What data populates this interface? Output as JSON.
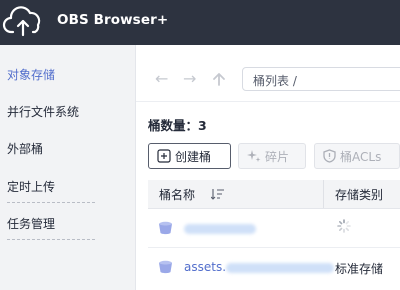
{
  "app": {
    "title": "OBS Browser+"
  },
  "sidebar": {
    "items": [
      {
        "label": "对象存储",
        "active": true
      },
      {
        "label": "并行文件系统",
        "active": false
      },
      {
        "label": "外部桶",
        "active": false
      },
      {
        "label": "定时上传",
        "active": false
      },
      {
        "label": "任务管理",
        "active": false
      }
    ]
  },
  "nav": {
    "path": "桶列表 /"
  },
  "summary": {
    "bucket_count": "桶数量：3"
  },
  "toolbar": {
    "create_bucket": "创建桶",
    "fragments": "碎片",
    "bucket_acls": "桶ACLs"
  },
  "table": {
    "columns": [
      "桶名称",
      "存储类别"
    ],
    "rows": [
      {
        "name": "",
        "storage_class": ""
      },
      {
        "name": "assets.",
        "storage_class": "标准存储"
      }
    ]
  },
  "colors": {
    "header": "#2d3340",
    "accent": "#526ecc",
    "sidebar": "#f2f3f5",
    "bucket_icon": "#9aa8e8"
  }
}
